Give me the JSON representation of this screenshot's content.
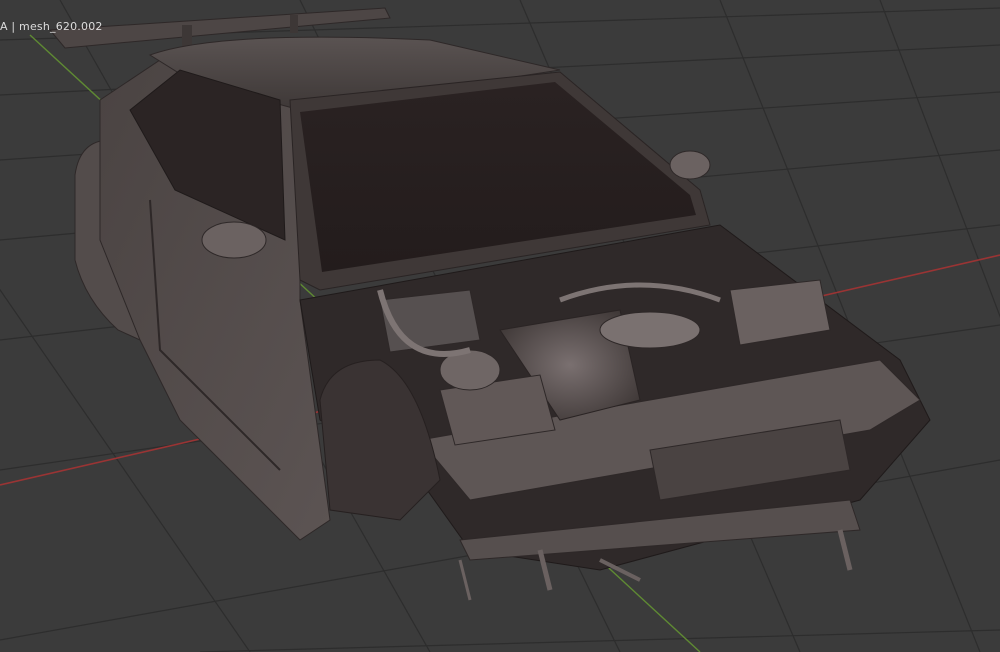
{
  "viewport": {
    "object_label": "A | mesh_620.002",
    "object_name": "mesh_620.002",
    "shading_mode": "solid",
    "background_color": "#3b3b3b",
    "grid_color": "#2a2a2a",
    "x_axis_color": "#b03a3a",
    "y_axis_color": "#6f9a3a",
    "mesh_color": "#4a4444"
  }
}
